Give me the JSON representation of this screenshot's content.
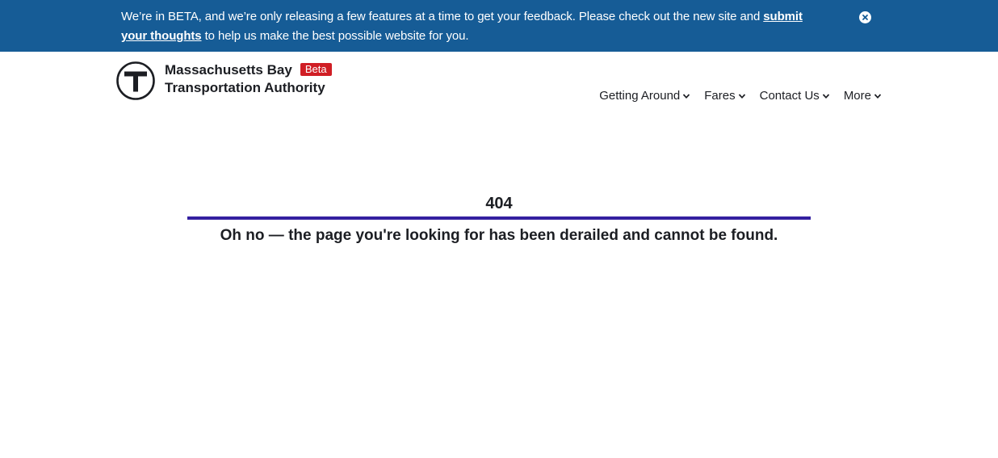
{
  "banner": {
    "text_before": "We’re in BETA, and we’re only releasing a few features at a time to get your feedback. Please check out the new site and ",
    "link_label": "submit your thoughts",
    "text_after": " to help us make the best possible website for you.",
    "close_icon": "close-circle-icon",
    "background": "#165c96"
  },
  "header": {
    "org_line1": "Massachusetts Bay",
    "org_line2": "Transportation Authority",
    "badge": "Beta",
    "badge_color": "#d01e25",
    "logo_icon": "mbta-t-logo-icon"
  },
  "nav": {
    "items": [
      {
        "label": "Getting Around",
        "icon": "chevron-down-icon"
      },
      {
        "label": "Fares",
        "icon": "chevron-down-icon"
      },
      {
        "label": "Contact Us",
        "icon": "chevron-down-icon"
      },
      {
        "label": "More",
        "icon": "chevron-down-icon"
      }
    ]
  },
  "error": {
    "code": "404",
    "message": "Oh no — the page you're looking for has been derailed and cannot be found.",
    "rule_color": "#3420a0"
  }
}
